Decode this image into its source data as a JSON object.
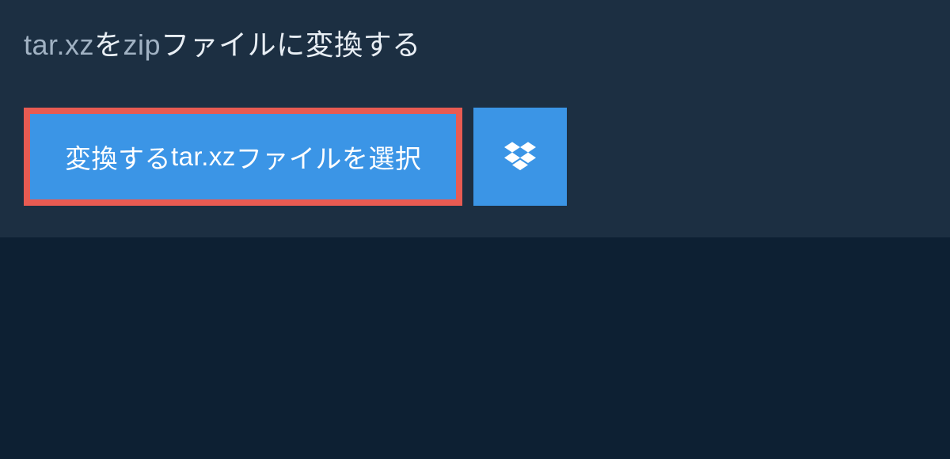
{
  "title": {
    "part1": "tar.xz",
    "part2": "を",
    "part3": "zip",
    "part4": "ファイルに変換する"
  },
  "buttons": {
    "select_prefix": "変換する",
    "select_format": "tar.xz",
    "select_suffix": "ファイルを選択"
  },
  "colors": {
    "bg_dark": "#0d2033",
    "bg_panel": "#1c2f42",
    "button_bg": "#3b95e6",
    "highlight_border": "#e85b52",
    "text_light": "#a1b2c3",
    "text_white": "#e8eef4"
  }
}
